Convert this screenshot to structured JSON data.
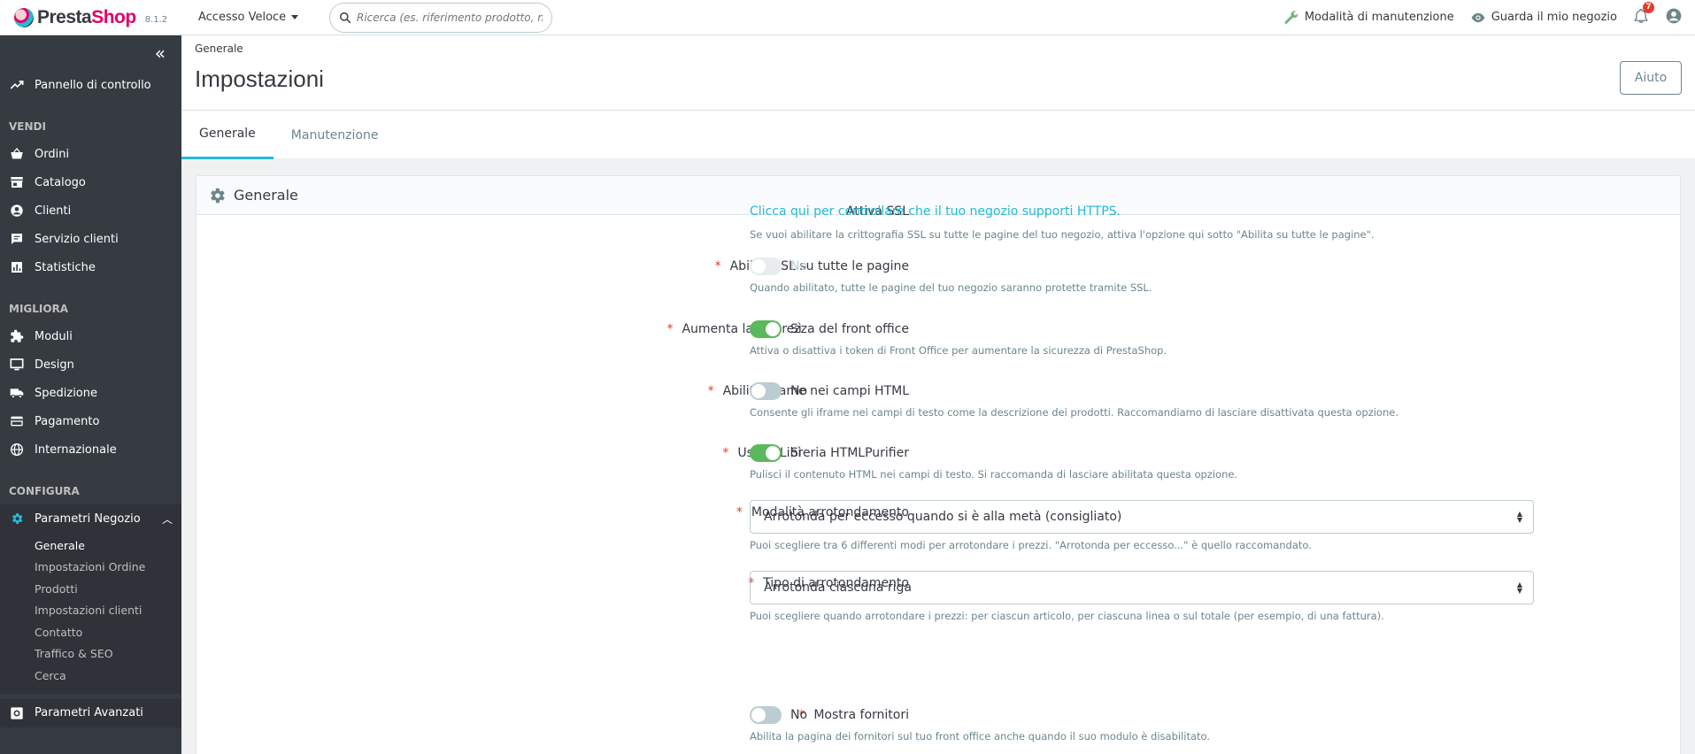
{
  "header": {
    "logo_text_a": "Presta",
    "logo_text_b": "Shop",
    "version": "8.1.2",
    "quick_access": "Accesso Veloce",
    "search_placeholder": "Ricerca (es. riferimento prodotto, nom",
    "maintenance_link": "Modalità di manutenzione",
    "view_store_link": "Guarda il mio negozio",
    "notifications_count": "7"
  },
  "sidebar": {
    "dashboard": "Pannello di controllo",
    "sections": {
      "sell": "VENDI",
      "improve": "MIGLIORA",
      "configure": "CONFIGURA"
    },
    "sell_items": [
      "Ordini",
      "Catalogo",
      "Clienti",
      "Servizio clienti",
      "Statistiche"
    ],
    "improve_items": [
      "Moduli",
      "Design",
      "Spedizione",
      "Pagamento",
      "Internazionale"
    ],
    "shop_params": "Parametri Negozio",
    "shop_params_sub": [
      "Generale",
      "Impostazioni Ordine",
      "Prodotti",
      "Impostazioni clienti",
      "Contatto",
      "Traffico & SEO",
      "Cerca"
    ],
    "advanced_params": "Parametri Avanzati"
  },
  "page": {
    "breadcrumb": "Generale",
    "title": "Impostazioni",
    "help_button": "Aiuto",
    "tabs": [
      "Generale",
      "Manutenzione"
    ]
  },
  "card": {
    "title": "Generale",
    "rows": {
      "ssl": {
        "label": "Attiva SSL",
        "link": "Clicca qui per controllare che il tuo negozio supporti HTTPS.",
        "help": "Se vuoi abilitare la crittografia SSL su tutte le pagine del tuo negozio, attiva l'opzione qui sotto \"Abilita su tutte le pagine\"."
      },
      "ssl_all": {
        "label": "Abilita SSL su tutte le pagine",
        "state": "No",
        "help": "Quando abilitato, tutte le pagine del tuo negozio saranno protette tramite SSL."
      },
      "front_security": {
        "label": "Aumenta la sicurezza del front office",
        "state": "Sì",
        "help": "Attiva o disattiva i token di Front Office per aumentare la sicurezza di PrestaShop."
      },
      "iframe": {
        "label": "Abilita iframe nei campi HTML",
        "state": "No",
        "help": "Consente gli iframe nei campi di testo come la descrizione dei prodotti. Raccomandiamo di lasciare disattivata questa opzione."
      },
      "purifier": {
        "label": "Usa la Libreria HTMLPurifier",
        "state": "Sì",
        "help": "Pulisci il contenuto HTML nei campi di testo. Si raccomanda di lasciare abilitata questa opzione."
      },
      "round_mode": {
        "label": "Modalità arrotondamento",
        "value": "Arrotonda per eccesso quando si è alla metà (consigliato)",
        "help": "Puoi scegliere tra 6 differenti modi per arrotondare i prezzi. \"Arrotonda per eccesso...\" è quello raccomandato."
      },
      "round_type": {
        "label": "Tipo di arrotondamento",
        "value": "Arrotonda ciascuna riga",
        "help": "Puoi scegliere quando arrotondare i prezzi: per ciascun articolo, per ciascuna linea o sul totale (per esempio, di una fattura)."
      },
      "suppliers": {
        "label": "Mostra fornitori",
        "state": "No",
        "help": "Abilita la pagina dei fornitori sul tuo front office anche quando il suo modulo è disabilitato."
      }
    }
  },
  "colors": {
    "accent": "#25b9d7",
    "brand": "#df0067",
    "sidebar": "#363a41",
    "switch_on": "#5cb85c",
    "required": "#e43c30"
  }
}
